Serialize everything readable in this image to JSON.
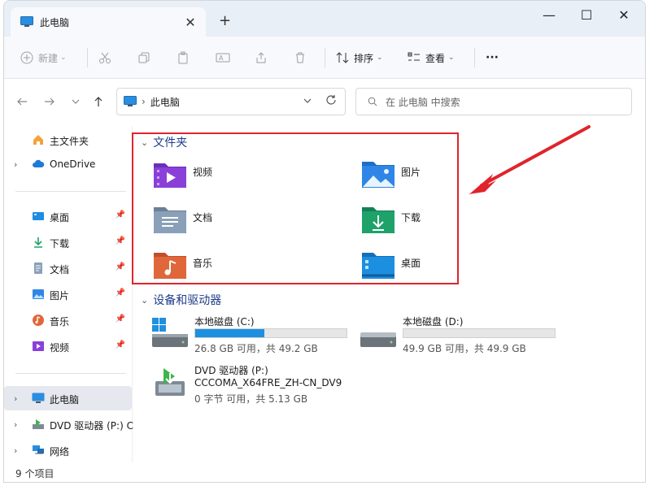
{
  "window": {
    "tab_title": "此电脑",
    "tab_close": "✕",
    "new_tab": "+",
    "min": "—",
    "max": "☐",
    "close": "✕"
  },
  "toolbar": {
    "new_label": "新建",
    "sort_label": "排序",
    "view_label": "查看",
    "more_label": "···"
  },
  "address": {
    "crumb": "此电脑",
    "search_placeholder": "在 此电脑 中搜索"
  },
  "sidebar": {
    "items": [
      {
        "label": "主文件夹",
        "icon": "home-icon"
      },
      {
        "label": "OneDrive",
        "icon": "cloud-icon"
      },
      {
        "label": "桌面",
        "icon": "desktop-icon"
      },
      {
        "label": "下载",
        "icon": "download-icon"
      },
      {
        "label": "文档",
        "icon": "document-icon"
      },
      {
        "label": "图片",
        "icon": "picture-icon"
      },
      {
        "label": "音乐",
        "icon": "music-icon"
      },
      {
        "label": "视频",
        "icon": "video-icon"
      },
      {
        "label": "此电脑",
        "icon": "computer-icon"
      },
      {
        "label": "DVD 驱动器 (P:) C",
        "icon": "dvd-icon"
      },
      {
        "label": "网络",
        "icon": "network-icon"
      }
    ]
  },
  "folders": {
    "heading": "文件夹",
    "items": [
      {
        "label": "视频",
        "color": "#8b3fd9"
      },
      {
        "label": "图片",
        "color": "#2f86e6"
      },
      {
        "label": "文档",
        "color": "#7a8fa6"
      },
      {
        "label": "下载",
        "color": "#1ea26a"
      },
      {
        "label": "音乐",
        "color": "#e0673a"
      },
      {
        "label": "桌面",
        "color": "#1c8fe0"
      }
    ]
  },
  "drives": {
    "heading": "设备和驱动器",
    "items": [
      {
        "name": "本地磁盘 (C:)",
        "size": "26.8 GB 可用，共 49.2 GB",
        "used_fraction": 0.455
      },
      {
        "name": "本地磁盘 (D:)",
        "size": "49.9 GB 可用，共 49.9 GB",
        "used_fraction": 0.0
      },
      {
        "name": "DVD 驱动器 (P:)",
        "sub": "CCCOMA_X64FRE_ZH-CN_DV9",
        "size": "0 字节 可用，共 5.13 GB"
      }
    ]
  },
  "status": {
    "count": "9 个项目"
  },
  "colors": {
    "accent": "#1e90e0",
    "highlight": "#e0242c"
  }
}
